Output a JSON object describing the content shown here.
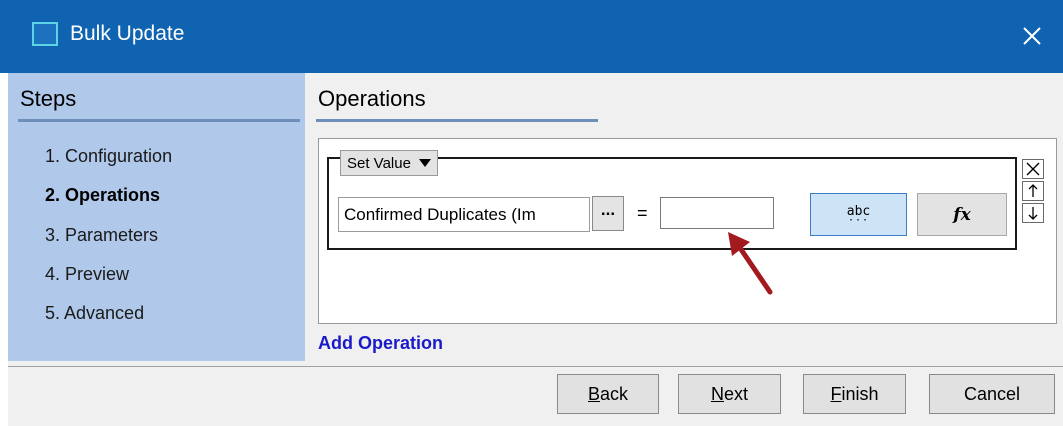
{
  "window": {
    "title": "Bulk Update",
    "accent_color": "#0f63b0",
    "close_icon": "close-icon"
  },
  "steps": {
    "title": "Steps",
    "items": [
      {
        "label": "1. Configuration",
        "active": false
      },
      {
        "label": "2. Operations",
        "active": true
      },
      {
        "label": "3. Parameters",
        "active": false
      },
      {
        "label": "4. Preview",
        "active": false
      },
      {
        "label": "5. Advanced",
        "active": false
      }
    ]
  },
  "operations": {
    "title": "Operations",
    "operation_type": "Set Value",
    "field_name": "Confirmed Duplicates (Im",
    "browse_label": "...",
    "equals_label": "=",
    "value": "",
    "literal_mode_icon": "abc-literal-icon",
    "formula_mode_icon": "fx-formula-icon",
    "remove_icon": "remove-x-icon",
    "move_up_icon": "up-arrow-icon",
    "move_down_icon": "down-arrow-icon",
    "add_operation_label": "Add Operation"
  },
  "footer": {
    "back_label": {
      "hotkey": "B",
      "rest": "ack"
    },
    "next_label": {
      "hotkey": "N",
      "rest": "ext"
    },
    "finish_label": {
      "hotkey": "F",
      "rest": "inish"
    },
    "cancel_label": "Cancel"
  },
  "annotation": {
    "arrow_color": "#a31920"
  }
}
